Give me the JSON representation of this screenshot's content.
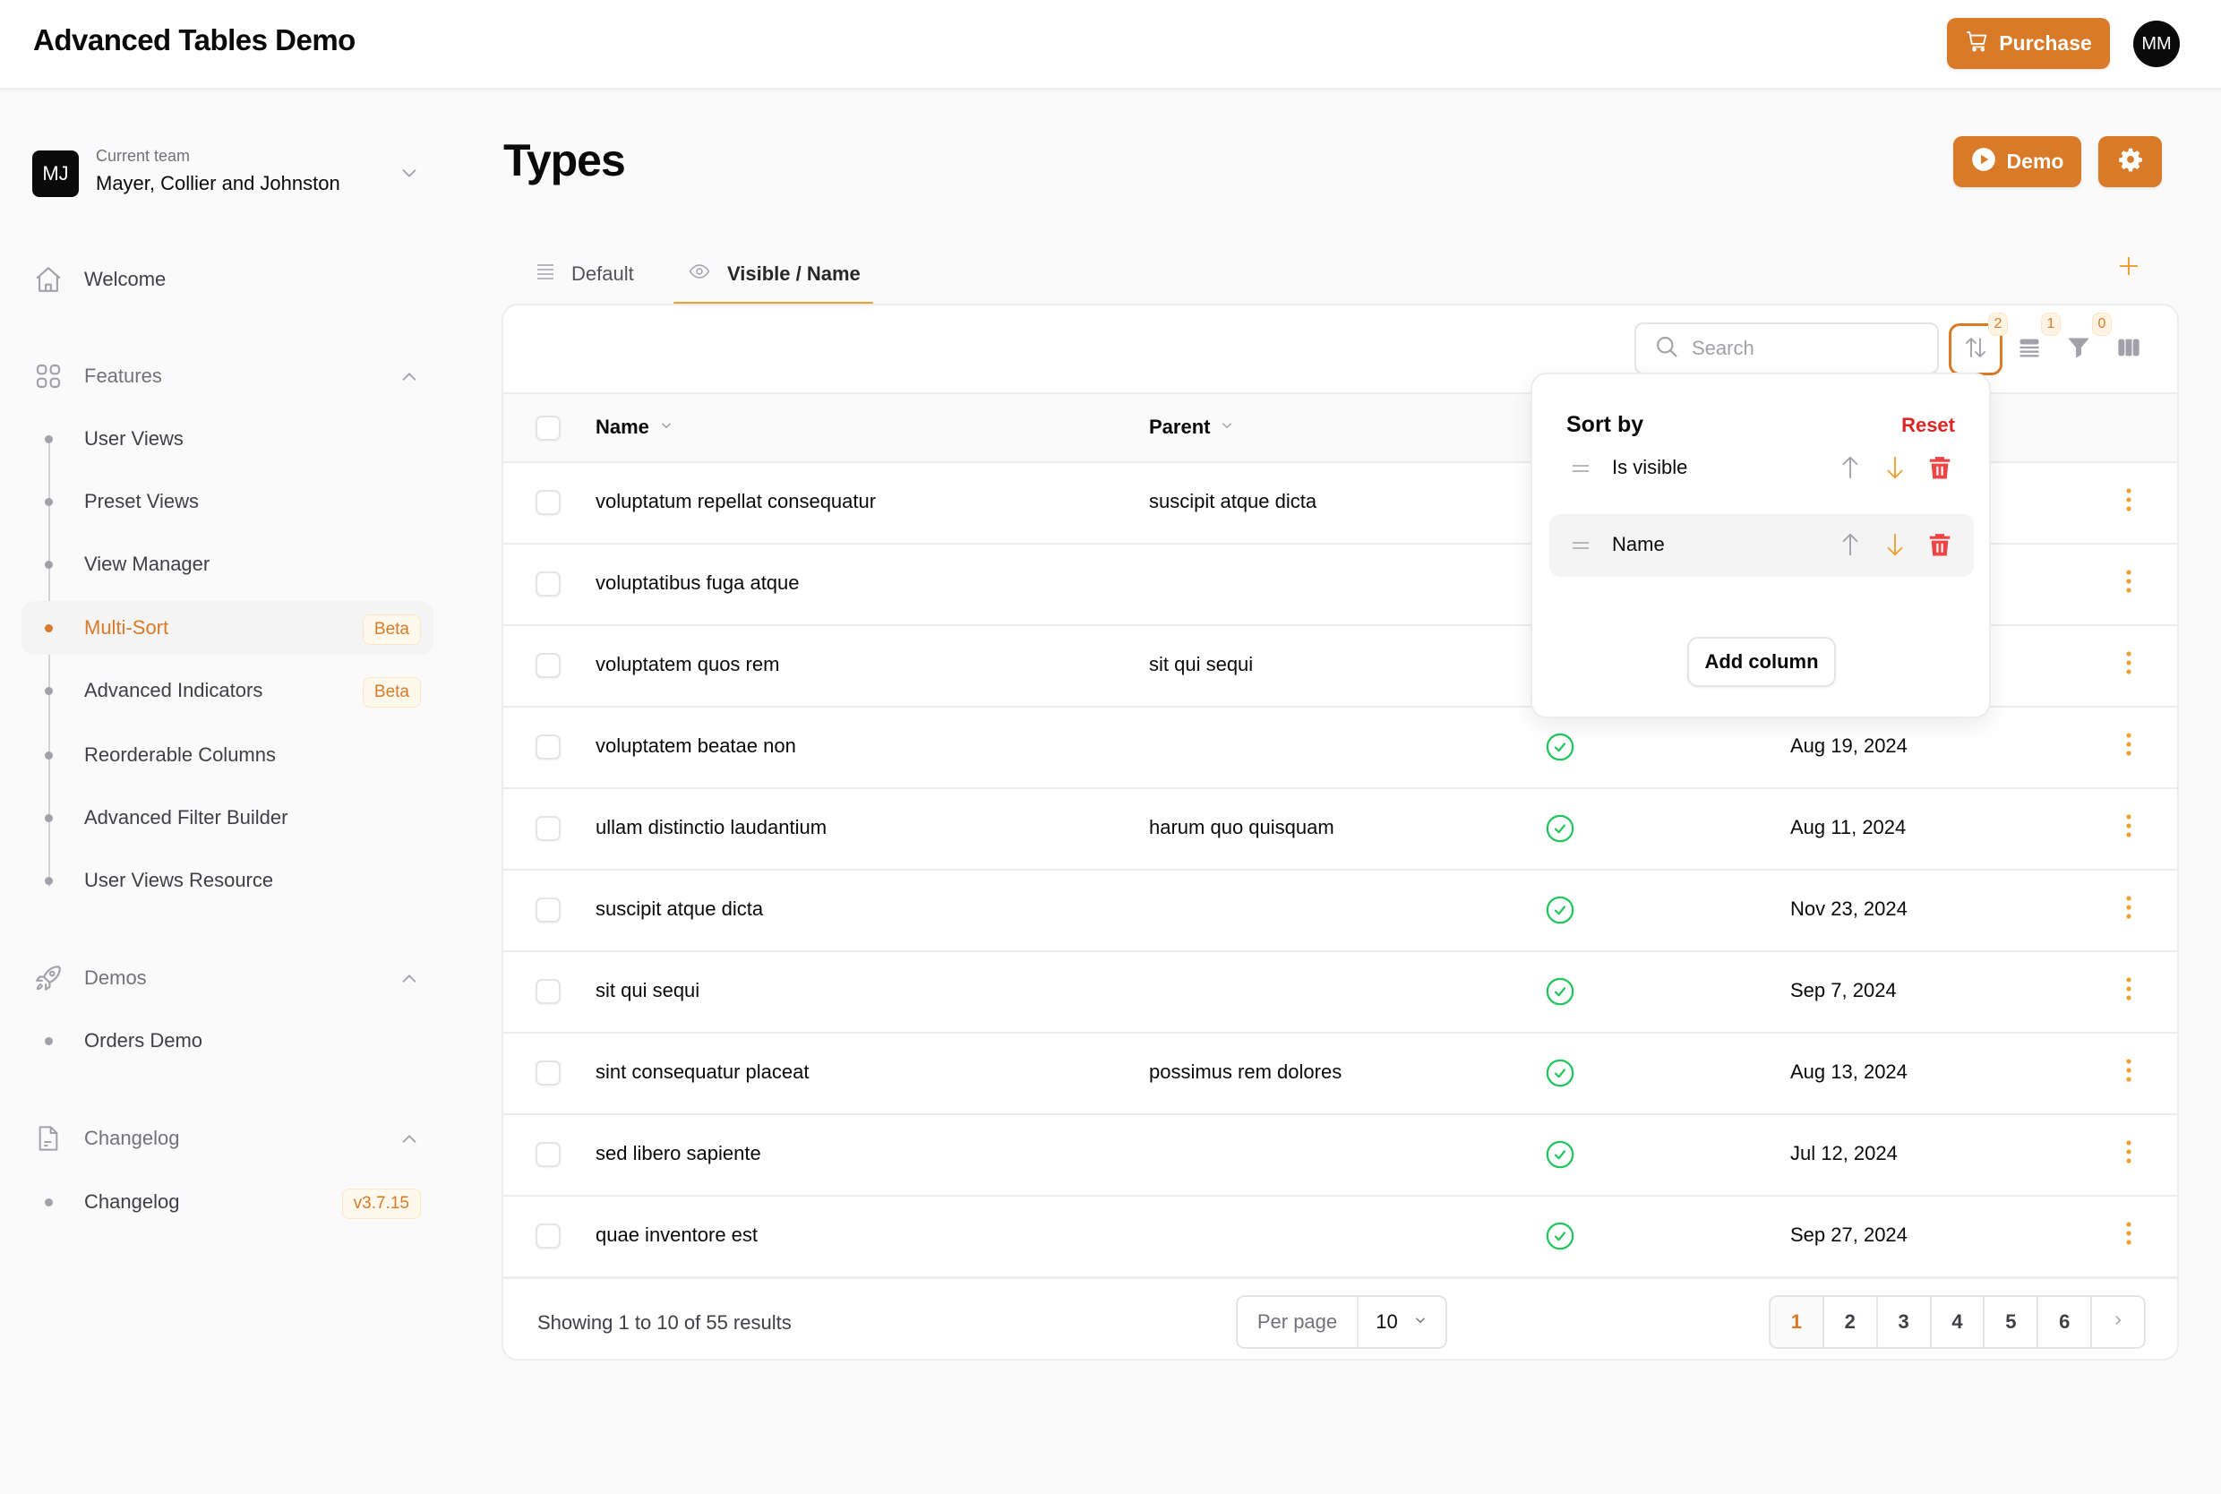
{
  "app": {
    "title": "Advanced Tables Demo",
    "purchase_label": "Purchase",
    "user_initials": "MM",
    "accent_color": "#d97a28"
  },
  "team": {
    "initials": "MJ",
    "label": "Current team",
    "name": "Mayer, Collier and Johnston"
  },
  "sidebar": {
    "welcome": "Welcome",
    "features": {
      "label": "Features",
      "items": [
        {
          "label": "User Views",
          "badge": null,
          "active": false
        },
        {
          "label": "Preset Views",
          "badge": null,
          "active": false
        },
        {
          "label": "View Manager",
          "badge": null,
          "active": false
        },
        {
          "label": "Multi-Sort",
          "badge": "Beta",
          "active": true
        },
        {
          "label": "Advanced Indicators",
          "badge": "Beta",
          "active": false
        },
        {
          "label": "Reorderable Columns",
          "badge": null,
          "active": false
        },
        {
          "label": "Advanced Filter Builder",
          "badge": null,
          "active": false
        },
        {
          "label": "User Views Resource",
          "badge": null,
          "active": false
        }
      ]
    },
    "demos": {
      "label": "Demos",
      "items": [
        {
          "label": "Orders Demo"
        }
      ]
    },
    "changelog": {
      "label": "Changelog",
      "items": [
        {
          "label": "Changelog",
          "badge": "v3.7.15"
        }
      ]
    }
  },
  "page": {
    "title": "Types",
    "demo_label": "Demo",
    "tabs": [
      {
        "label": "Default",
        "icon": "list-icon",
        "active": false
      },
      {
        "label": "Visible / Name",
        "icon": "eye-icon",
        "active": true
      }
    ]
  },
  "toolbar": {
    "search_placeholder": "Search",
    "search_value": "",
    "sort_count": "2",
    "group_count": "1",
    "filter_count": "0"
  },
  "table": {
    "columns": [
      {
        "label": "Name"
      },
      {
        "label": "Parent"
      }
    ],
    "rows": [
      {
        "name": "voluptatum repellat consequatur",
        "parent": "suscipit atque dicta",
        "visible": null,
        "date": ""
      },
      {
        "name": "voluptatibus fuga atque",
        "parent": "",
        "visible": null,
        "date": ""
      },
      {
        "name": "voluptatem quos rem",
        "parent": "sit qui sequi",
        "visible": null,
        "date": ""
      },
      {
        "name": "voluptatem beatae non",
        "parent": "",
        "visible": true,
        "date": "Aug 19, 2024"
      },
      {
        "name": "ullam distinctio laudantium",
        "parent": "harum quo quisquam",
        "visible": true,
        "date": "Aug 11, 2024"
      },
      {
        "name": "suscipit atque dicta",
        "parent": "",
        "visible": true,
        "date": "Nov 23, 2024"
      },
      {
        "name": "sit qui sequi",
        "parent": "",
        "visible": true,
        "date": "Sep 7, 2024"
      },
      {
        "name": "sint consequatur placeat",
        "parent": "possimus rem dolores",
        "visible": true,
        "date": "Aug 13, 2024"
      },
      {
        "name": "sed libero sapiente",
        "parent": "",
        "visible": true,
        "date": "Jul 12, 2024"
      },
      {
        "name": "quae inventore est",
        "parent": "",
        "visible": true,
        "date": "Sep 27, 2024"
      }
    ]
  },
  "footer": {
    "showing": "Showing 1 to 10 of 55 results",
    "per_page_label": "Per page",
    "per_page_value": "10",
    "pages": [
      "1",
      "2",
      "3",
      "4",
      "5",
      "6"
    ],
    "current_page": "1"
  },
  "sort_popover": {
    "title": "Sort by",
    "reset_label": "Reset",
    "items": [
      {
        "label": "Is visible",
        "direction": "desc"
      },
      {
        "label": "Name",
        "direction": "desc"
      }
    ],
    "add_column_label": "Add column"
  }
}
